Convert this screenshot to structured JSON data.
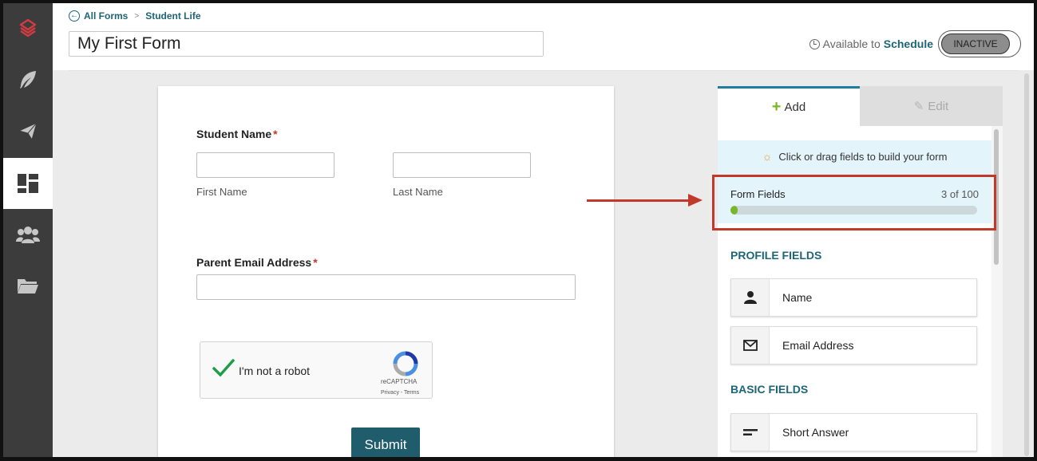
{
  "nav": {
    "items": [
      {
        "name": "logo",
        "active": false
      },
      {
        "name": "feather",
        "active": false
      },
      {
        "name": "send",
        "active": false
      },
      {
        "name": "dashboard",
        "active": true
      },
      {
        "name": "groups",
        "active": false
      },
      {
        "name": "folder",
        "active": false
      }
    ]
  },
  "header": {
    "crumb_all_forms": "All Forms",
    "crumb_separator": ">",
    "crumb_current": "Student Life",
    "form_title": "My First Form",
    "available_to": "Available to",
    "schedule": "Schedule",
    "status": "INACTIVE"
  },
  "form": {
    "student_name_label": "Student Name",
    "required_mark": "*",
    "first_name": "First Name",
    "last_name": "Last Name",
    "parent_email_label": "Parent Email Address",
    "captcha_text": "I'm not a robot",
    "captcha_brand": "reCAPTCHA",
    "captcha_links": "Privacy - Terms",
    "submit": "Submit"
  },
  "panel": {
    "tab_add": "Add",
    "tab_edit": "Edit",
    "hint": "Click or drag fields to build your form",
    "form_fields_label": "Form Fields",
    "form_fields_count": "3 of 100",
    "form_fields_progress": 0.03,
    "profile_fields_heading": "PROFILE FIELDS",
    "profile_fields": [
      {
        "label": "Name",
        "icon": "person-icon"
      },
      {
        "label": "Email Address",
        "icon": "envelope-icon"
      }
    ],
    "basic_fields_heading": "BASIC FIELDS",
    "basic_fields": [
      {
        "label": "Short Answer",
        "icon": "short-answer-icon"
      }
    ]
  },
  "colors": {
    "accent": "#1d6577",
    "progress": "#76b82a",
    "highlight": "#c0392b"
  }
}
